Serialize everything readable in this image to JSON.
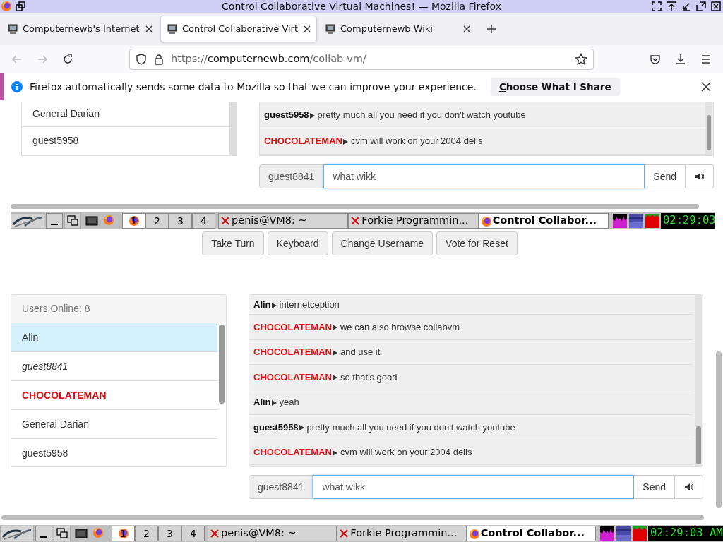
{
  "window": {
    "title": "Control Collaborative Virtual Machines! — Mozilla Firefox"
  },
  "tabs": [
    {
      "label": "Computernewb's Internet",
      "selected": false
    },
    {
      "label": "Control Collaborative Virt",
      "selected": true
    },
    {
      "label": "Computernewb Wiki",
      "selected": false
    }
  ],
  "url": {
    "scheme": "https://",
    "host": "computernewb.com",
    "path": "/collab-vm/"
  },
  "notification": {
    "text": "Firefox automatically sends some data to Mozilla so that we can improve your experience.",
    "button": "Choose What I Share"
  },
  "vm_screen": {
    "users": [
      {
        "name": "General Darian",
        "kind": "user",
        "selected": false
      },
      {
        "name": "guest5958",
        "kind": "user",
        "selected": false
      }
    ],
    "messages": [
      {
        "user": "guest5958",
        "kind": "user",
        "text": "pretty much all you need if you don't watch youtube"
      },
      {
        "user": "CHOCOLATEMAN",
        "kind": "admin",
        "text": "cvm will work on your 2004 dells"
      }
    ],
    "input": {
      "username": "guest8841",
      "value": "what wikk"
    },
    "send": "Send",
    "taskbar": {
      "workspaces": [
        {
          "label": "1",
          "selected": true
        },
        {
          "label": "2",
          "selected": false
        },
        {
          "label": "3",
          "selected": false
        },
        {
          "label": "4",
          "selected": false
        }
      ],
      "tasks": [
        {
          "label": "penis@VM8: ~",
          "kind": "terminal",
          "selected": false
        },
        {
          "label": "Forkie Programmin...",
          "kind": "terminal",
          "selected": false
        },
        {
          "label": "Control Collabor...",
          "kind": "browser",
          "selected": true
        }
      ],
      "clock": "02:29:03"
    }
  },
  "controls": [
    "Take Turn",
    "Keyboard",
    "Change Username",
    "Vote for Reset"
  ],
  "users_panel": {
    "header": "Users Online: 8",
    "users": [
      {
        "name": "Alin",
        "kind": "user",
        "selected": true
      },
      {
        "name": "guest8841",
        "kind": "self",
        "selected": false
      },
      {
        "name": "CHOCOLATEMAN",
        "kind": "admin",
        "selected": false
      },
      {
        "name": "General Darian",
        "kind": "user",
        "selected": false
      },
      {
        "name": "guest5958",
        "kind": "user",
        "selected": false
      }
    ]
  },
  "messages": [
    {
      "user": "Alin",
      "kind": "user",
      "text": "internetception"
    },
    {
      "user": "CHOCOLATEMAN",
      "kind": "admin",
      "text": "we can also browse collabvm"
    },
    {
      "user": "CHOCOLATEMAN",
      "kind": "admin",
      "text": "and use it"
    },
    {
      "user": "CHOCOLATEMAN",
      "kind": "admin",
      "text": "so that's good"
    },
    {
      "user": "Alin",
      "kind": "user",
      "text": "yeah"
    },
    {
      "user": "guest5958",
      "kind": "user",
      "text": "pretty much all you need if you don't watch youtube"
    },
    {
      "user": "CHOCOLATEMAN",
      "kind": "admin",
      "text": "cvm will work on your 2004 dells"
    }
  ],
  "input": {
    "username": "guest8841",
    "value": "what wikk"
  },
  "send": "Send",
  "taskbar": {
    "workspaces": [
      {
        "label": "1",
        "selected": true
      },
      {
        "label": "2",
        "selected": false
      },
      {
        "label": "3",
        "selected": false
      },
      {
        "label": "4",
        "selected": false
      }
    ],
    "tasks": [
      {
        "label": "penis@VM8: ~",
        "kind": "terminal",
        "selected": false
      },
      {
        "label": "Forkie Programmin...",
        "kind": "terminal",
        "selected": false
      },
      {
        "label": "Control Collabor...",
        "kind": "browser",
        "selected": true
      }
    ],
    "clock": "02:29:03 AM"
  }
}
